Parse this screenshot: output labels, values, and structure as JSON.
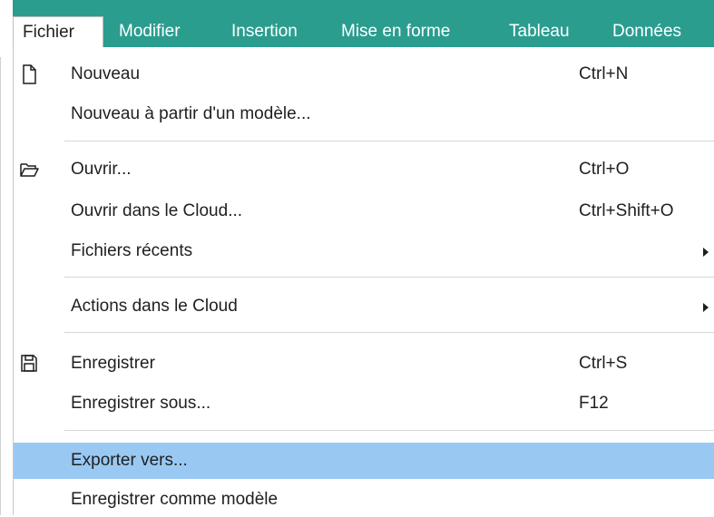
{
  "menubar": {
    "items": [
      {
        "label": "Fichier",
        "active": true
      },
      {
        "label": "Modifier"
      },
      {
        "label": "Insertion"
      },
      {
        "label": "Mise en forme"
      },
      {
        "label": "Tableau"
      },
      {
        "label": "Données"
      }
    ]
  },
  "file_menu": {
    "items": [
      {
        "label": "Nouveau",
        "shortcut": "Ctrl+N",
        "icon": "new-document-icon"
      },
      {
        "label": "Nouveau à partir d'un modèle..."
      },
      {
        "label": "Ouvrir...",
        "shortcut": "Ctrl+O",
        "icon": "open-folder-icon"
      },
      {
        "label": "Ouvrir dans le Cloud...",
        "shortcut": "Ctrl+Shift+O"
      },
      {
        "label": "Fichiers récents",
        "submenu": true
      },
      {
        "label": "Actions dans le Cloud",
        "submenu": true
      },
      {
        "label": "Enregistrer",
        "shortcut": "Ctrl+S",
        "icon": "save-icon"
      },
      {
        "label": "Enregistrer sous...",
        "shortcut": "F12"
      },
      {
        "label": "Exporter vers...",
        "highlighted": true
      },
      {
        "label": "Enregistrer comme modèle"
      }
    ]
  },
  "colors": {
    "menubar_bg": "#2a9d8f",
    "highlight": "#99c9f3"
  }
}
